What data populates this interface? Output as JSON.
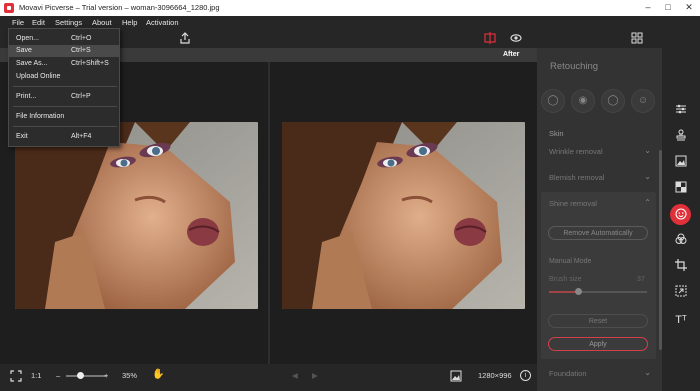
{
  "window": {
    "title": "Movavi Picverse – Trial version – woman-3096664_1280.jpg"
  },
  "menubar": {
    "file": "File",
    "edit": "Edit",
    "settings": "Settings",
    "about": "About",
    "help": "Help",
    "activation": "Activation"
  },
  "file_menu": [
    {
      "label": "Open...",
      "shortcut": "Ctrl+O"
    },
    {
      "label": "Save",
      "shortcut": "Ctrl+S"
    },
    {
      "label": "Save As...",
      "shortcut": "Ctrl+Shift+S"
    },
    {
      "label": "Upload Online",
      "shortcut": ""
    },
    {
      "label": "Print...",
      "shortcut": "Ctrl+P"
    },
    {
      "label": "File Information",
      "shortcut": ""
    },
    {
      "label": "Exit",
      "shortcut": "Alt+F4"
    }
  ],
  "canvas": {
    "after_label": "After"
  },
  "bottombar": {
    "ratio": "1:1",
    "zoom": "35%",
    "dimensions": "1280×996"
  },
  "zoom_level": 0.35,
  "panel": {
    "title": "Retouching",
    "skin_section": "Skin",
    "wrinkle_removal": "Wrinkle removal",
    "blemish_removal": "Blemish removal",
    "shine_removal": "Shine removal",
    "remove_automatically": "Remove Automatically",
    "manual_mode": "Manual Mode",
    "brush_size_label": "Brush size",
    "brush_size_value": "37",
    "brush_size_fraction": 0.3,
    "reset": "Reset",
    "apply": "Apply",
    "foundation": "Foundation"
  },
  "colors": {
    "accent": "#e0303a",
    "apply_border": "#d0424a",
    "background": "#2b2b2b",
    "panel": "#333333"
  },
  "icons": {
    "toolbar": [
      "share-icon",
      "compare-split-icon",
      "eye-icon",
      "grid-icon",
      "pencil-icon"
    ],
    "face_tools": [
      "face-icon",
      "eye-icon",
      "lips-icon",
      "head-icon"
    ],
    "sidebar": [
      "adjust-sliders-icon",
      "stamp-icon",
      "image-icon",
      "checker-icon",
      "retouch-face-icon",
      "color-circles-icon",
      "crop-icon",
      "resize-icon",
      "text-icon"
    ]
  }
}
